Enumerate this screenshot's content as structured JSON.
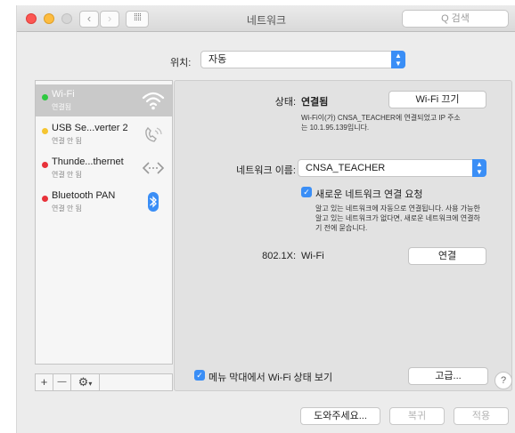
{
  "window": {
    "title": "네트워크",
    "search_placeholder": "Q 검색",
    "grid_glyph": "⁞⁞⁞⁞"
  },
  "location": {
    "label": "위치:",
    "value": "자동"
  },
  "services": [
    {
      "name": "Wi-Fi",
      "status": "연결됨",
      "dot_color": "#2ec940",
      "icon": "wifi-icon",
      "selected": true
    },
    {
      "name": "USB Se...verter 2",
      "status": "연결 안 됨",
      "dot_color": "#f5c531",
      "icon": "phone-icon",
      "selected": false
    },
    {
      "name": "Thunde...thernet",
      "status": "연결 안 됨",
      "dot_color": "#e8323a",
      "icon": "ethernet-icon",
      "selected": false
    },
    {
      "name": "Bluetooth PAN",
      "status": "연결 안 됨",
      "dot_color": "#e8323a",
      "icon": "bluetooth-icon",
      "selected": false
    }
  ],
  "sidebar_toolbar": {
    "add": "+",
    "remove": "—",
    "gear": "⚙"
  },
  "detail": {
    "status_label": "상태:",
    "status_value": "연결됨",
    "wifi_off_button": "Wi-Fi 끄기",
    "status_desc_line1": "Wi-Fi이(가) CNSA_TEACHER에 연결되었고 IP 주소",
    "status_desc_line2": "는 10.1.95.139입니다.",
    "network_name_label": "네트워크 이름:",
    "network_name_value": "CNSA_TEACHER",
    "ask_join_label": "새로운 네트워크 연결 요청",
    "ask_join_checked": true,
    "ask_desc_line1": "알고 있는 네트워크에 자동으로 연결됩니다. 사용 가능한",
    "ask_desc_line2": "알고 있는 네트워크가 없다면, 새로운 네트워크에 연결하",
    "ask_desc_line3": "기 전에 묻습니다.",
    "dot1x_label": "802.1X:",
    "dot1x_value": "Wi-Fi",
    "connect_button": "연결",
    "menubar_label": "메뉴 막대에서 Wi-Fi 상태 보기",
    "menubar_checked": true,
    "advanced_button": "고급...",
    "help_button": "?"
  },
  "footer": {
    "assist_button": "도와주세요...",
    "revert_button": "복귀",
    "apply_button": "적용"
  },
  "colors": {
    "accent": "#3a8ef6",
    "selection": "#c9c9c9"
  }
}
